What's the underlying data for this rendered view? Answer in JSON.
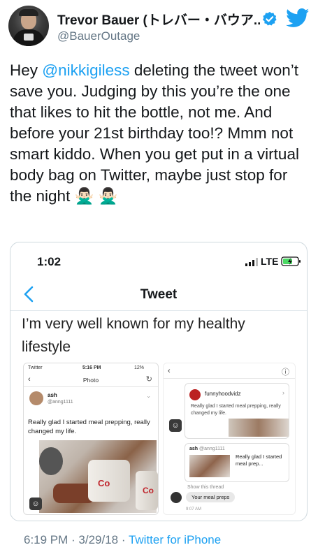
{
  "author": {
    "name": "Trevor Bauer (トレバー・バウア...",
    "handle": "@BauerOutage",
    "verified_color": "#1da1f2"
  },
  "tweet": {
    "mention": "@nikkigiless",
    "text_before": "Hey ",
    "text_after": " deleting the tweet won’t save you. Judging by this you’re the one that likes to hit the bottle, not me. And before your 21st birthday too!? Mmm not smart kiddo. When you get put in a virtual body bag on Twitter, maybe just stop for the night ",
    "emoji": "🙅🏻‍♂️ 🙅🏻‍♂️"
  },
  "embedded": {
    "status_time": "1:02",
    "network": "LTE",
    "nav_title": "Tweet",
    "text": "I’m very well known for my healthy lifestyle",
    "shot1": {
      "status_left": "Twitter",
      "status_time": "5:16 PM",
      "status_right": "12%",
      "nav_title": "Photo",
      "user_name": "ash",
      "user_handle": "@anng1111",
      "body": "Really glad I started meal prepping, really changed my life.",
      "can_text": "Co",
      "can_text2": "Co"
    },
    "shot2": {
      "card_name": "funnyhoodvidz",
      "card_text": "Really glad I started meal prepping, really changed my life.",
      "reply_header_name": "ash",
      "reply_header_handle": "@anng1111",
      "reply_body": "Really glad I started meal prep...",
      "show_thread": "Show this thread",
      "bubble": "Your meal preps",
      "time": "9:07 AM"
    }
  },
  "footer": {
    "timestamp": "6:19 PM · 3/29/18 · ",
    "app": "Twitter for iPhone"
  },
  "colors": {
    "link": "#1da1f2",
    "secondary": "#657786"
  }
}
